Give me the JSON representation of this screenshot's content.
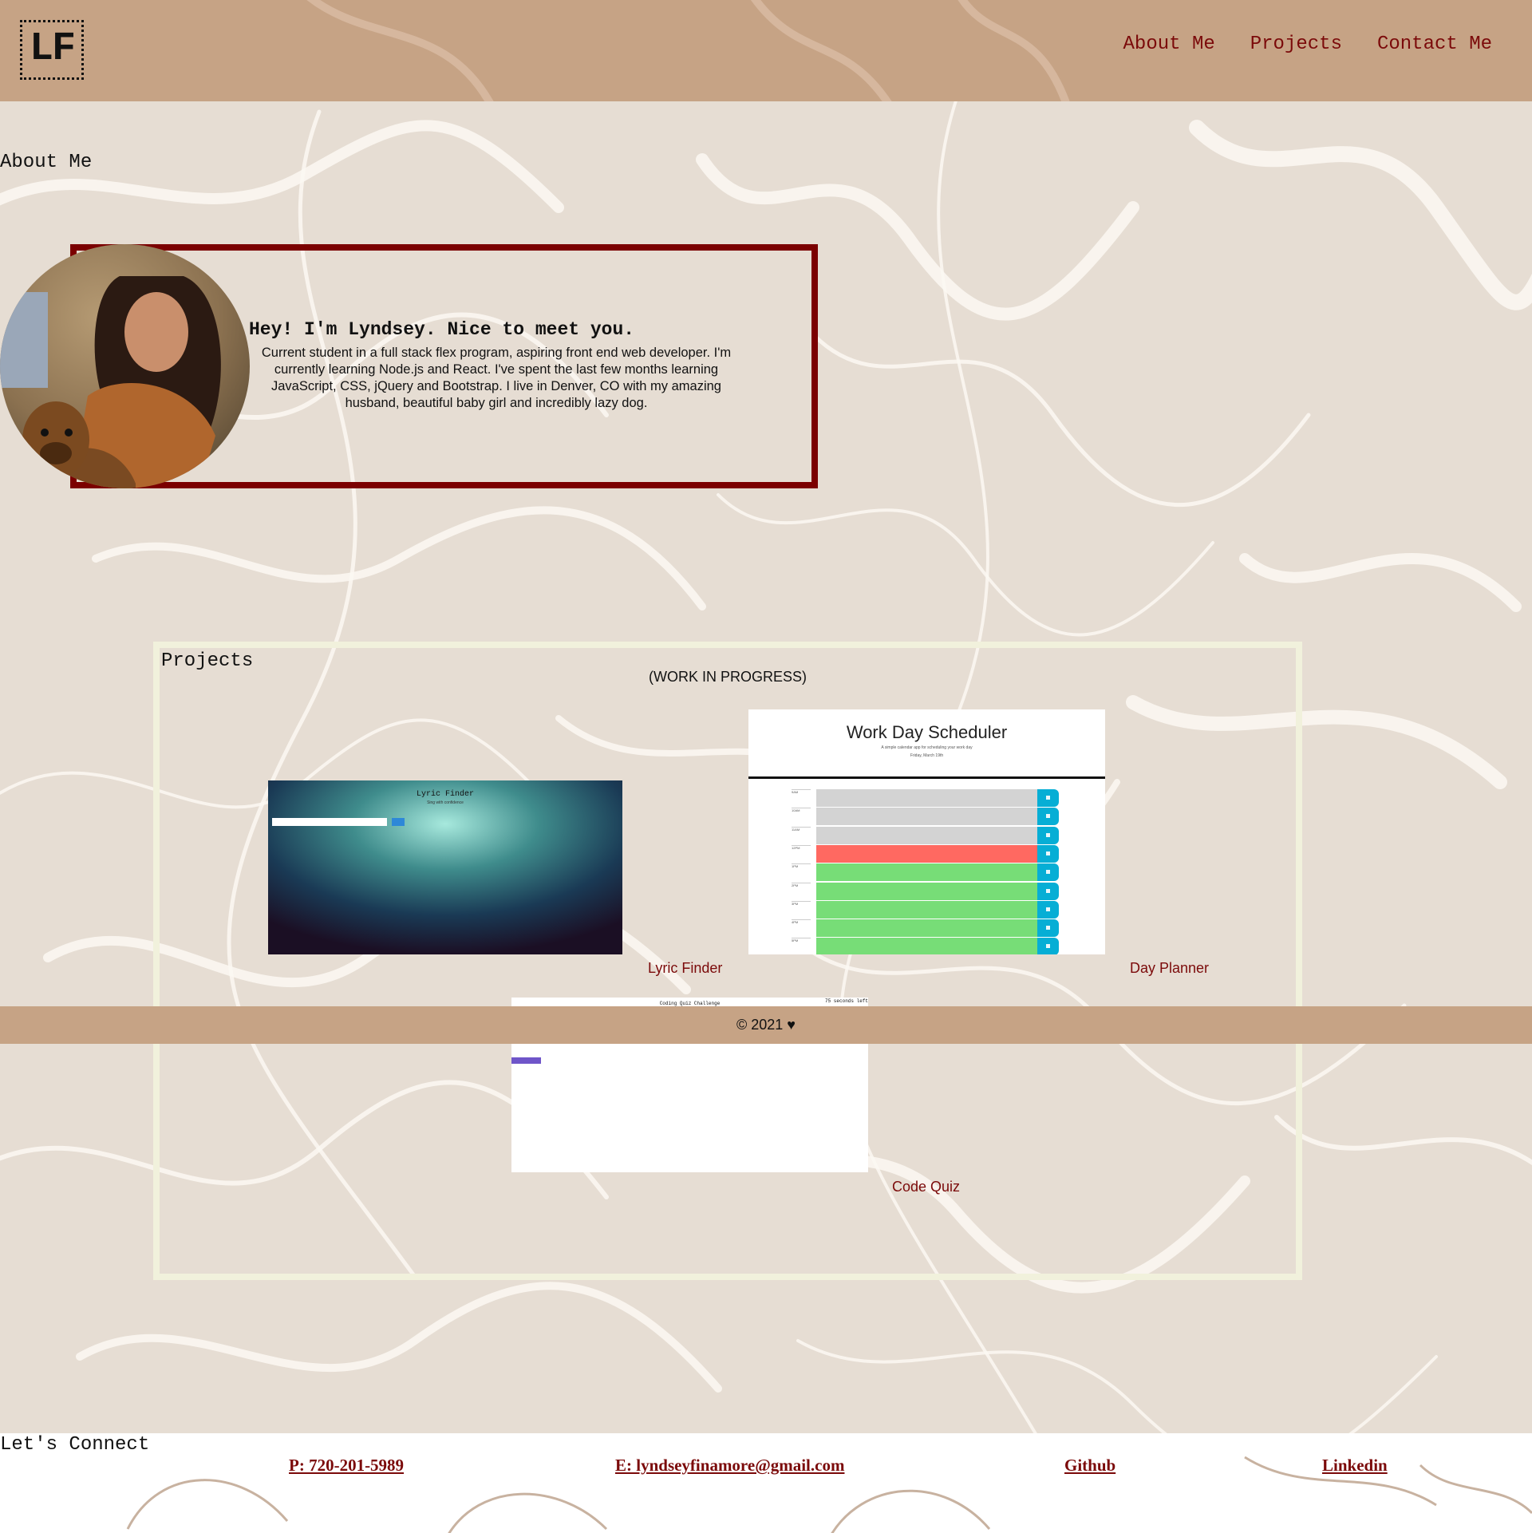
{
  "header": {
    "logo_text": "LF",
    "nav": [
      {
        "label": "About Me"
      },
      {
        "label": "Projects"
      },
      {
        "label": "Contact Me"
      }
    ]
  },
  "about": {
    "section_title": "About Me",
    "heading": "Hey! I'm Lyndsey. Nice to meet you.",
    "body": "Current student in a full stack flex program, aspiring front end web developer. I'm currently learning Node.js and React. I've spent the last few months learning JavaScript, CSS, jQuery and Bootstrap. I live in Denver, CO with my amazing husband, beautiful baby girl and incredibly lazy dog."
  },
  "projects": {
    "section_title": "Projects",
    "status": "(WORK IN PROGRESS)",
    "items": [
      {
        "label": "Lyric Finder",
        "screenshot_title": "Lyric Finder",
        "screenshot_subtitle": "Sing with confidence"
      },
      {
        "label": "Day Planner",
        "screenshot_title": "Work Day Scheduler",
        "screenshot_subtitle": "A simple calendar app for scheduling your work day",
        "screenshot_date": "Friday, March 19th",
        "hours": [
          "9AM",
          "10AM",
          "11AM",
          "12PM",
          "1PM",
          "2PM",
          "3PM",
          "4PM",
          "5PM"
        ]
      },
      {
        "label": "Code Quiz",
        "screenshot_title": "Coding Quiz Challenge",
        "screenshot_timer": "75 seconds left"
      }
    ]
  },
  "footer": {
    "text": "© 2021 ♥"
  },
  "connect": {
    "section_title": "Let's Connect",
    "links": [
      {
        "label": "P: 720-201-5989"
      },
      {
        "label": "E: lyndseyfinamore@gmail.com"
      },
      {
        "label": "Github"
      },
      {
        "label": "Linkedin"
      }
    ]
  },
  "colors": {
    "accent": "#7b0a0a",
    "header_bg": "#c6a385",
    "page_bg": "#e6ddd3",
    "projects_border": "#f1f1dc",
    "about_border": "#7b0000"
  }
}
